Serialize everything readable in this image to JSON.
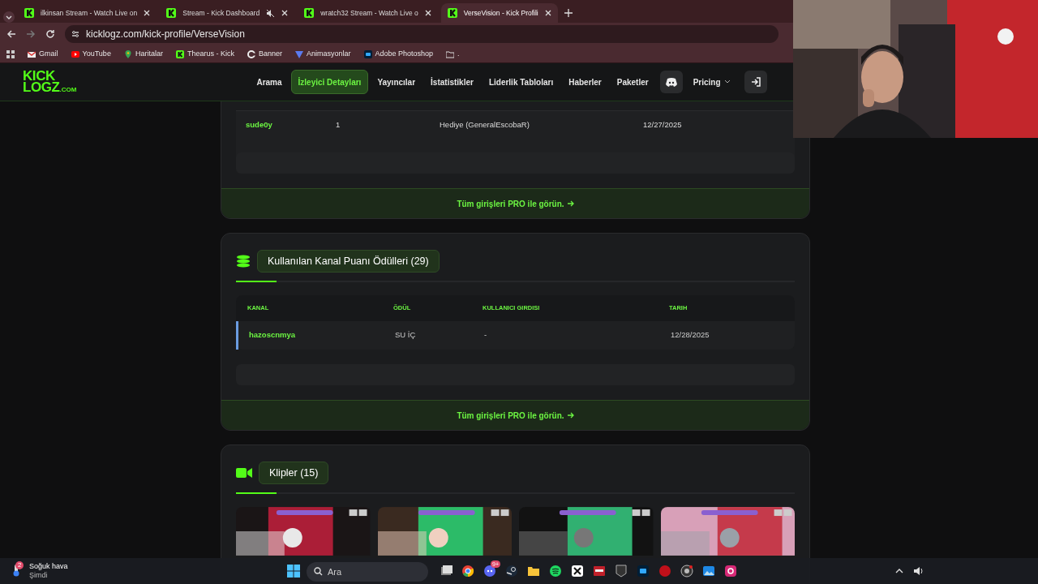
{
  "browser": {
    "tabs": [
      {
        "title": "ilkinsan Stream - Watch Live on",
        "selected": false,
        "muted": false
      },
      {
        "title": "Stream - Kick Dashboard",
        "selected": false,
        "muted": true
      },
      {
        "title": "wratch32 Stream - Watch Live o",
        "selected": false,
        "muted": false
      },
      {
        "title": "VerseVision - Kick Profili",
        "selected": true,
        "muted": false
      }
    ],
    "address": "kicklogz.com/kick-profile/VerseVision",
    "bookmarks": [
      {
        "label": "Gmail",
        "kind": "mail"
      },
      {
        "label": "YouTube",
        "kind": "video"
      },
      {
        "label": "Haritalar",
        "kind": "map"
      },
      {
        "label": "Thearus - Kick",
        "kind": "kick"
      },
      {
        "label": "Banner",
        "kind": "c"
      },
      {
        "label": "Animasyonlar",
        "kind": "v"
      },
      {
        "label": "Adobe Photoshop",
        "kind": "ps"
      },
      {
        "label": ".",
        "kind": "folder"
      }
    ]
  },
  "site": {
    "logo": [
      "KICK",
      "LOGZ",
      ".COM"
    ],
    "nav": [
      {
        "label": "Arama",
        "selected": false
      },
      {
        "label": "İzleyici Detayları",
        "selected": true
      },
      {
        "label": "Yayıncılar",
        "selected": false
      },
      {
        "label": "İstatistikler",
        "selected": false
      },
      {
        "label": "Liderlik Tabloları",
        "selected": false
      },
      {
        "label": "Haberler",
        "selected": false
      },
      {
        "label": "Paketler",
        "selected": false
      }
    ],
    "pricing": "Pricing"
  },
  "gift_table": {
    "rows": [
      [
        "sude0y",
        "1",
        "Hediye (GeneralEscobaR)",
        "12/27/2025"
      ]
    ],
    "more": "Tüm girişleri PRO ile görün."
  },
  "rewards": {
    "title": "Kullanılan Kanal Puanı Ödülleri (29)",
    "columns": [
      "KANAL",
      "ÖDÜL",
      "KULLANICI GIRDISI",
      "TARIH"
    ],
    "rows": [
      [
        "hazoscnmya",
        "SU İÇ",
        "-",
        "12/28/2025"
      ]
    ],
    "more": "Tüm girişleri PRO ile görün."
  },
  "clips": {
    "title": "Klipler (15)"
  },
  "taskbar": {
    "weather": {
      "badge": "2",
      "title": "Soğuk hava",
      "subtitle": "Şimdi"
    },
    "search_placeholder": "Ara",
    "discord_badge": "9+"
  }
}
